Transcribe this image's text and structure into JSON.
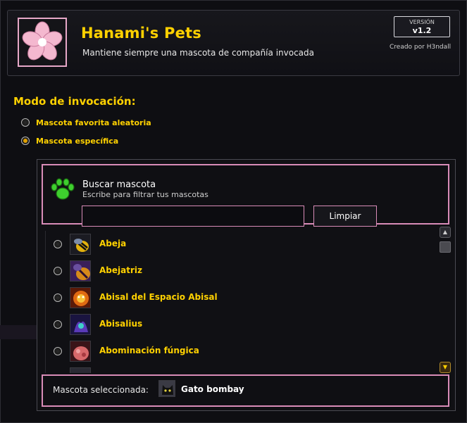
{
  "header": {
    "title": "Hanami's Pets",
    "subtitle": "Mantiene siempre una mascota de compañía invocada",
    "version_label": "VERSIÓN",
    "version_value": "v1.2",
    "author": "Creado por H3ndall",
    "logo_icon": "sakura-flower-icon"
  },
  "mode": {
    "title": "Modo de invocación:",
    "options": [
      {
        "label": "Mascota favorita aleatoria",
        "checked": false
      },
      {
        "label": "Mascota específica",
        "checked": true
      }
    ]
  },
  "search": {
    "icon": "paw-icon",
    "title": "Buscar mascota",
    "subtitle": "Escribe para filtrar tus mascotas",
    "value": "",
    "clear_label": "Limpiar"
  },
  "pets": [
    {
      "name": "Abeja",
      "icon": "bee-icon",
      "checked": false
    },
    {
      "name": "Abejatriz",
      "icon": "queen-bee-icon",
      "checked": false
    },
    {
      "name": "Abisal del Espacio Abisal",
      "icon": "fire-spirit-icon",
      "checked": false
    },
    {
      "name": "Abisalius",
      "icon": "void-creature-icon",
      "checked": false
    },
    {
      "name": "Abominación fúngica",
      "icon": "fungal-abomination-icon",
      "checked": false
    }
  ],
  "selected": {
    "label": "Mascota seleccionada:",
    "name": "Gato bombay",
    "icon": "black-cat-icon"
  },
  "colors": {
    "accent_gold": "#ffd100",
    "border_pink": "#d98cb8"
  }
}
